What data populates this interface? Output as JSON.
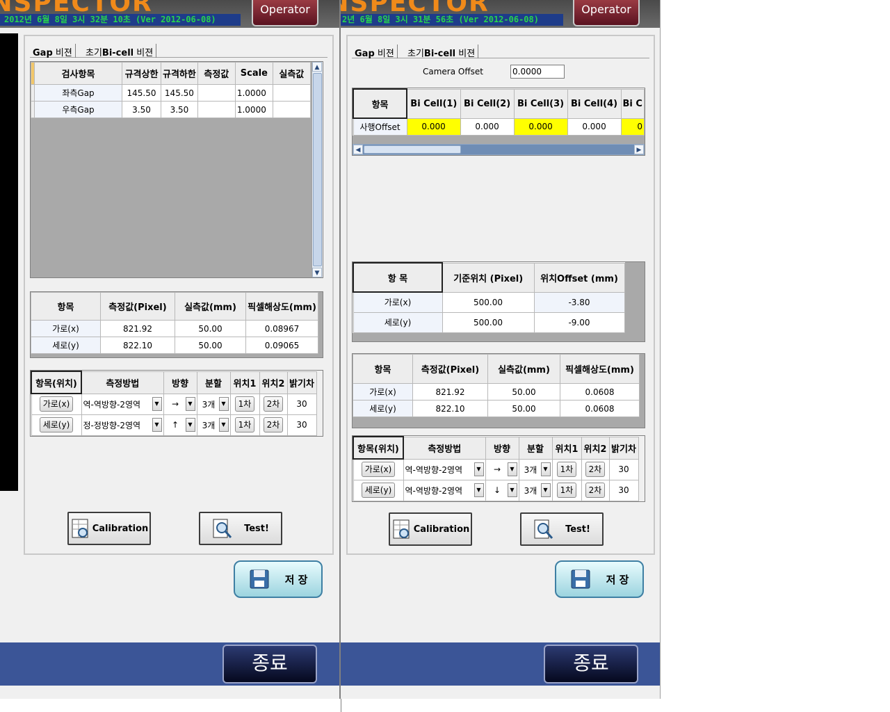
{
  "left": {
    "brand": "INSPECTOR",
    "datetime": "2012년 6월 8일 3시 32분 10초 (Ver 2012-06-08)",
    "operator": "Operator",
    "tabs": [
      {
        "bold": "Gap",
        "rest": " 비젼"
      },
      {
        "pre": "초기",
        "bold": "Bi-cell",
        "rest": " 비젼"
      }
    ],
    "gap_table": {
      "headers": [
        "검사항목",
        "규격상한",
        "규격하한",
        "측정값",
        "Scale",
        "실측값"
      ],
      "rows": [
        [
          "좌측Gap",
          "145.50",
          "145.50",
          "",
          "1.0000",
          ""
        ],
        [
          "우측Gap",
          "3.50",
          "3.50",
          "",
          "1.0000",
          ""
        ]
      ]
    },
    "pixel_table": {
      "headers": [
        "항목",
        "측정값(Pixel)",
        "실측값(mm)",
        "픽셀해상도(mm)"
      ],
      "rows": [
        [
          "가로(x)",
          "821.92",
          "50.00",
          "0.08967"
        ],
        [
          "세로(y)",
          "822.10",
          "50.00",
          "0.09065"
        ]
      ]
    },
    "method_table": {
      "headers": [
        "항목(위치)",
        "측정방법",
        "방향",
        "분할",
        "위치1",
        "위치2",
        "밝기차"
      ],
      "rows": [
        {
          "item": "가로(x)",
          "method": "역-역방향-2영역",
          "dir": "→",
          "div": "3개",
          "p1": "1차",
          "p2": "2차",
          "bright": "30"
        },
        {
          "item": "세로(y)",
          "method": "정-정방향-2영역",
          "dir": "↑",
          "div": "3개",
          "p1": "1차",
          "p2": "2차",
          "bright": "30"
        }
      ]
    },
    "calibration": "Calibration",
    "test": "Test!",
    "save": "저 장",
    "exit": "종료"
  },
  "right": {
    "brand": "INSPECTOR",
    "datetime": "2년 6월 8일 3시 31분 56초 (Ver 2012-06-08)",
    "operator": "Operator",
    "tabs": [
      {
        "bold": "Gap",
        "rest": " 비젼"
      },
      {
        "pre": "초기",
        "bold": "Bi-cell",
        "rest": " 비젼"
      }
    ],
    "camera_offset_label": "Camera Offset",
    "camera_offset_value": "0.0000",
    "bicell_table": {
      "headers": [
        "항목",
        "Bi Cell(1)",
        "Bi Cell(2)",
        "Bi Cell(3)",
        "Bi Cell(4)",
        "Bi C"
      ],
      "row": [
        "사행Offset",
        "0.000",
        "0.000",
        "0.000",
        "0.000",
        "0"
      ]
    },
    "position_table": {
      "headers": [
        "항 목",
        "기준위치 (Pixel)",
        "위치Offset (mm)"
      ],
      "rows": [
        [
          "가로(x)",
          "500.00",
          "-3.80"
        ],
        [
          "세로(y)",
          "500.00",
          "-9.00"
        ]
      ]
    },
    "pixel_table": {
      "headers": [
        "항목",
        "측정값(Pixel)",
        "실측값(mm)",
        "픽셀해상도(mm)"
      ],
      "rows": [
        [
          "가로(x)",
          "821.92",
          "50.00",
          "0.0608"
        ],
        [
          "세로(y)",
          "822.10",
          "50.00",
          "0.0608"
        ]
      ]
    },
    "method_table": {
      "headers": [
        "항목(위치)",
        "측정방법",
        "방향",
        "분할",
        "위치1",
        "위치2",
        "밝기차"
      ],
      "rows": [
        {
          "item": "가로(x)",
          "method": "역-역방향-2영역",
          "dir": "→",
          "div": "3개",
          "p1": "1차",
          "p2": "2차",
          "bright": "30"
        },
        {
          "item": "세로(y)",
          "method": "역-역방향-2영역",
          "dir": "↓",
          "div": "3개",
          "p1": "1차",
          "p2": "2차",
          "bright": "30"
        }
      ]
    },
    "calibration": "Calibration",
    "test": "Test!",
    "save": "저 장",
    "exit": "종료"
  },
  "colors": {
    "header_bg": "#555555",
    "date_bar": "#1e3c8a",
    "date_text": "#27d34d",
    "brand_text": "#f08a1a",
    "highlight_cell": "#ffff00",
    "footer": "#3b5597",
    "operator_btn": "#7a2030"
  }
}
